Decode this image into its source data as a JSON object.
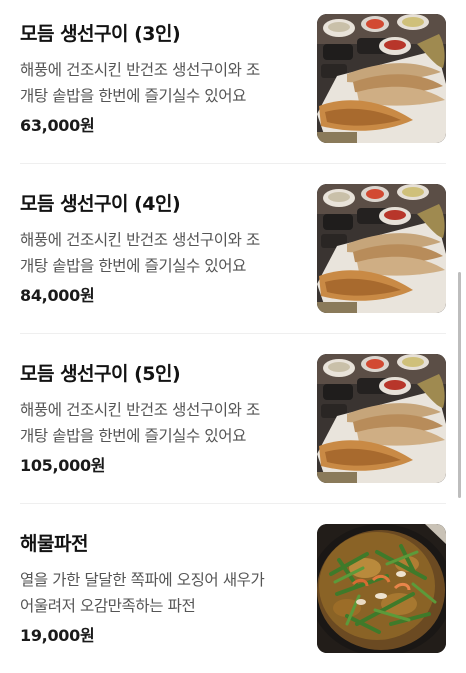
{
  "menu": {
    "items": [
      {
        "name": "모듬 생선구이 (3인)",
        "desc_line1": "해풍에 건조시킨 반건조 생선구이와 조",
        "desc_line2": "개탕 솥밥을 한번에 즐기실수 있어요",
        "price": "63,000원",
        "photo": "grilled-fish-platter"
      },
      {
        "name": "모듬 생선구이 (4인)",
        "desc_line1": "해풍에 건조시킨 반건조 생선구이와 조",
        "desc_line2": "개탕 솥밥을 한번에 즐기실수 있어요",
        "price": "84,000원",
        "photo": "grilled-fish-platter"
      },
      {
        "name": "모듬 생선구이 (5인)",
        "desc_line1": "해풍에 건조시킨 반건조 생선구이와 조",
        "desc_line2": "개탕 솥밥을 한번에 즐기실수 있어요",
        "price": "105,000원",
        "photo": "grilled-fish-platter"
      },
      {
        "name": "해물파전",
        "desc_line1": "열을 가한 달달한 쪽파에 오징어 새우가",
        "desc_line2": "어울려저 오감만족하는 파전",
        "price": "19,000원",
        "photo": "seafood-pancake"
      }
    ]
  }
}
